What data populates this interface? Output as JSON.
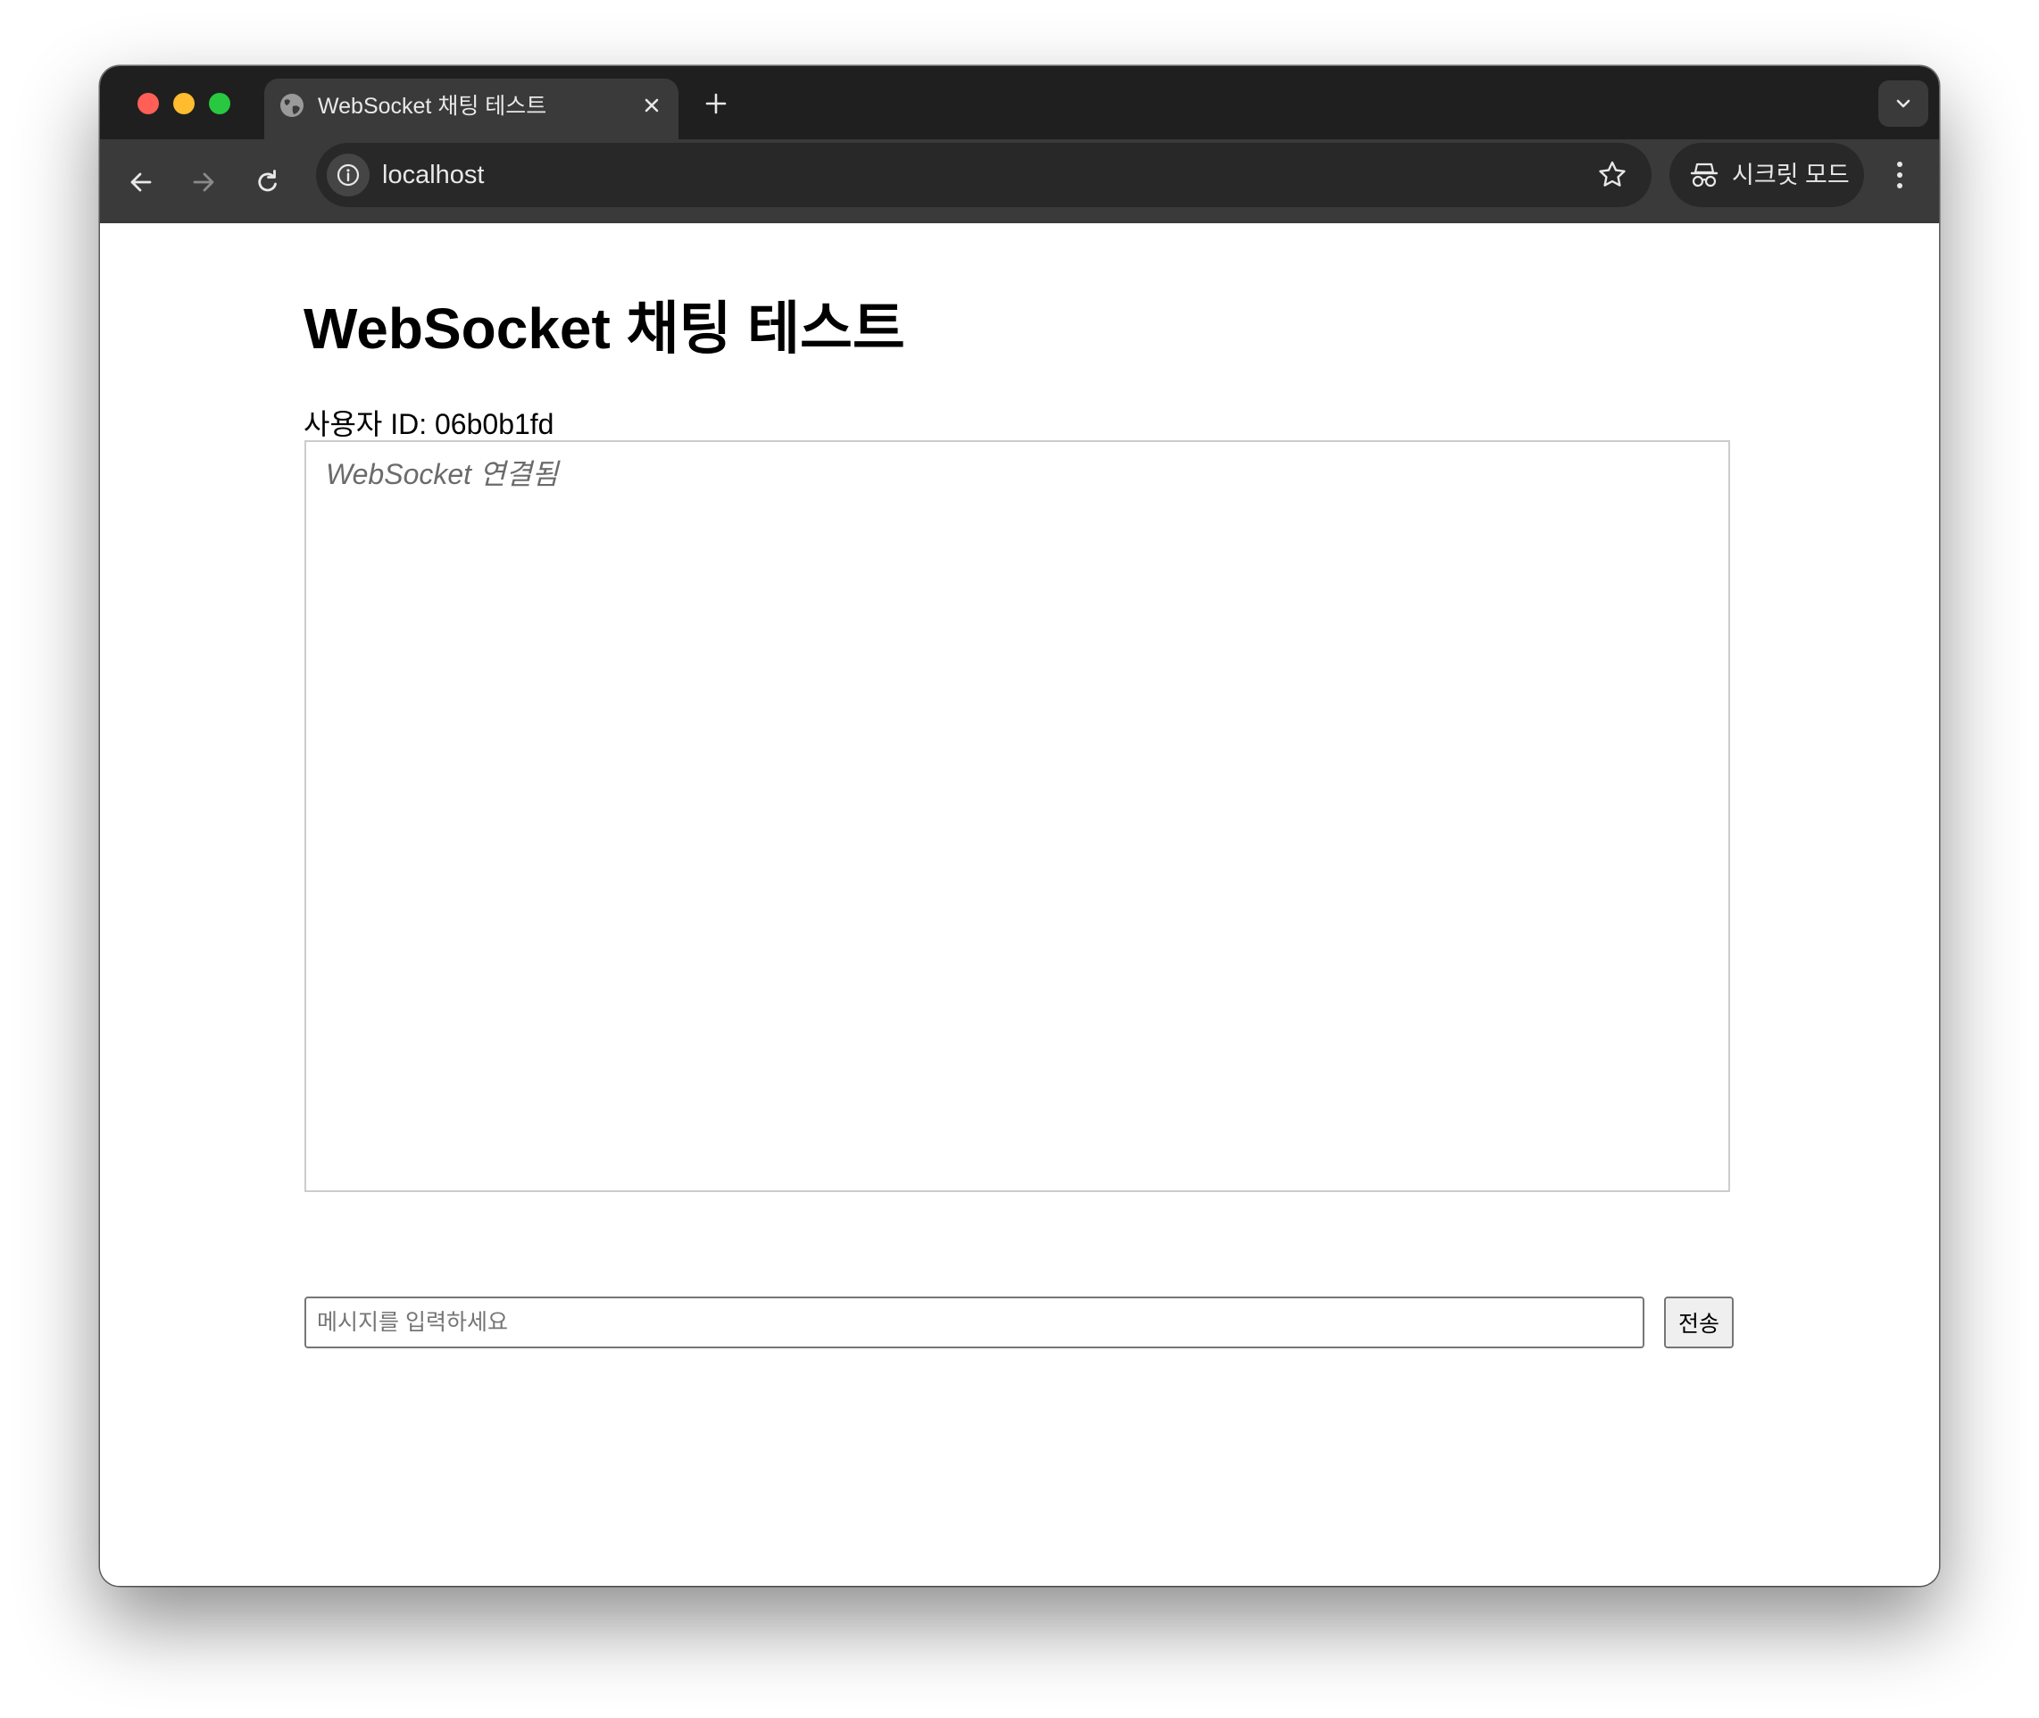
{
  "browser": {
    "tab": {
      "title": "WebSocket 채팅 테스트",
      "favicon_icon": "globe-icon",
      "close_icon": "close-icon"
    },
    "new_tab_icon": "plus-icon",
    "tab_search_icon": "chevron-down-icon",
    "nav": {
      "back_icon": "arrow-left-icon",
      "forward_icon": "arrow-right-icon",
      "reload_icon": "reload-icon"
    },
    "address_bar": {
      "info_icon": "info-icon",
      "url": "localhost",
      "bookmark_icon": "star-icon"
    },
    "incognito": {
      "icon": "incognito-icon",
      "label": "시크릿 모드"
    },
    "menu_icon": "more-vertical-icon"
  },
  "page": {
    "title": "WebSocket 채팅 테스트",
    "user_id_label": "사용자 ID:",
    "user_id": "06b0b1fd",
    "messages": [
      {
        "type": "system",
        "text": "WebSocket 연결됨"
      }
    ],
    "input": {
      "placeholder": "메시지를 입력하세요",
      "value": ""
    },
    "send_button": "전송"
  },
  "colors": {
    "titlebar": "#1f1f1f",
    "toolbar": "#3a3a3a",
    "omnibox": "#282828",
    "system_message": "#6b6b6b"
  }
}
